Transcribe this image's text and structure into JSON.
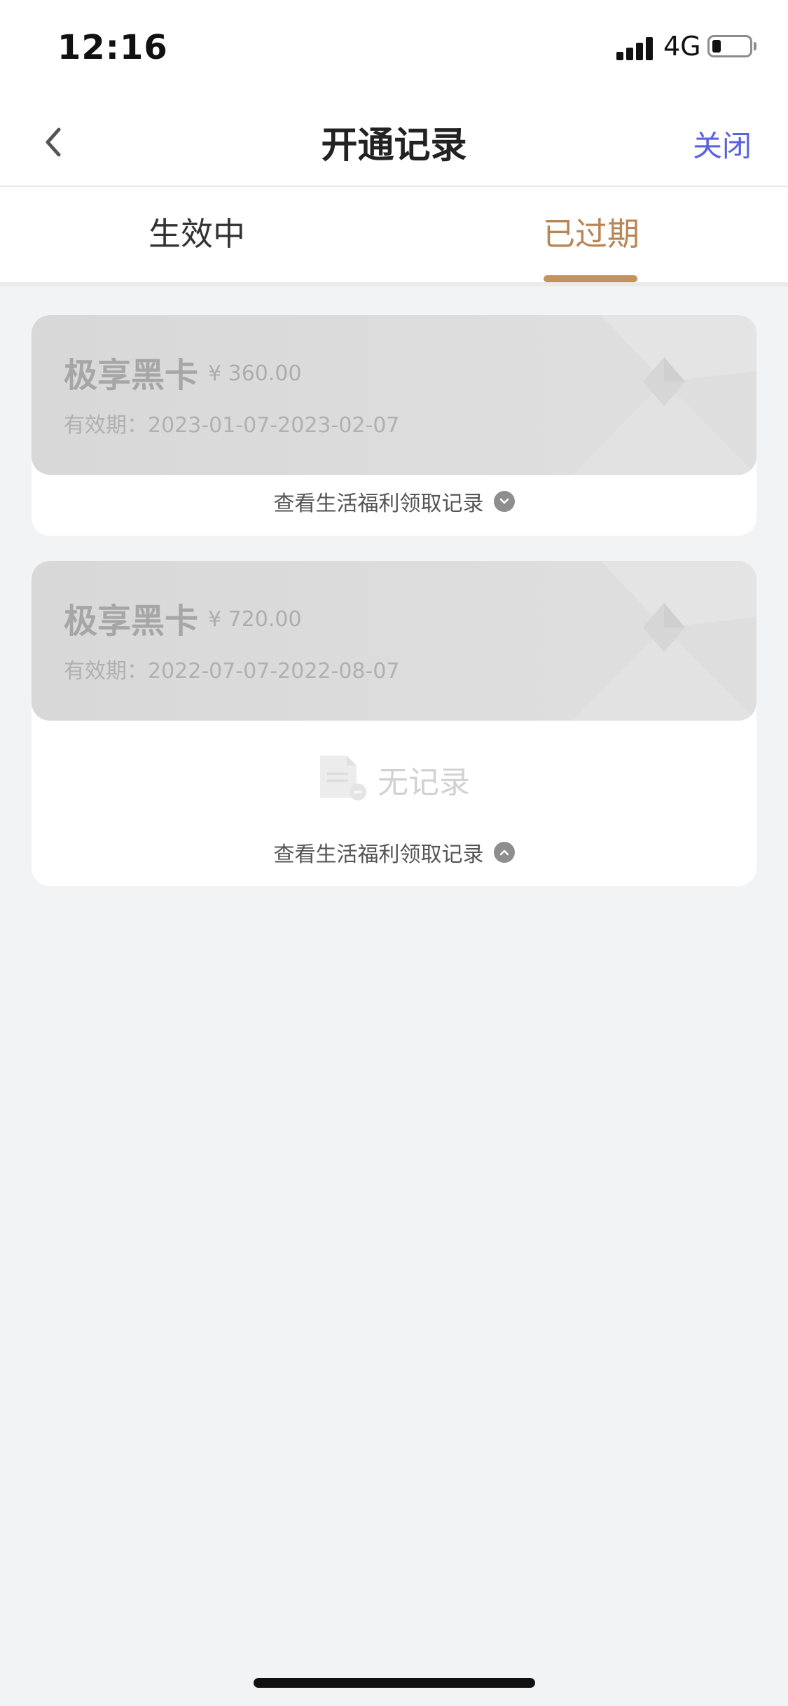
{
  "status_bar": {
    "time": "12:16",
    "network": "4G"
  },
  "nav": {
    "title": "开通记录",
    "close": "关闭"
  },
  "tabs": [
    {
      "label": "生效中",
      "active": false
    },
    {
      "label": "已过期",
      "active": true
    }
  ],
  "records": [
    {
      "name": "极享黑卡",
      "price": "¥ 360.00",
      "validity": "有效期：2023-01-07-2023-02-07",
      "toggle_label": "查看生活福利领取记录",
      "expanded": false
    },
    {
      "name": "极享黑卡",
      "price": "¥ 720.00",
      "validity": "有效期：2022-07-07-2022-08-07",
      "toggle_label": "查看生活福利领取记录",
      "expanded": true,
      "empty_text": "无记录"
    }
  ],
  "colors": {
    "accent": "#c3935f",
    "close": "#5a63e0",
    "background": "#f2f3f5"
  },
  "icons": [
    "back-chevron-icon",
    "chevron-down-icon",
    "chevron-up-icon",
    "document-icon"
  ]
}
